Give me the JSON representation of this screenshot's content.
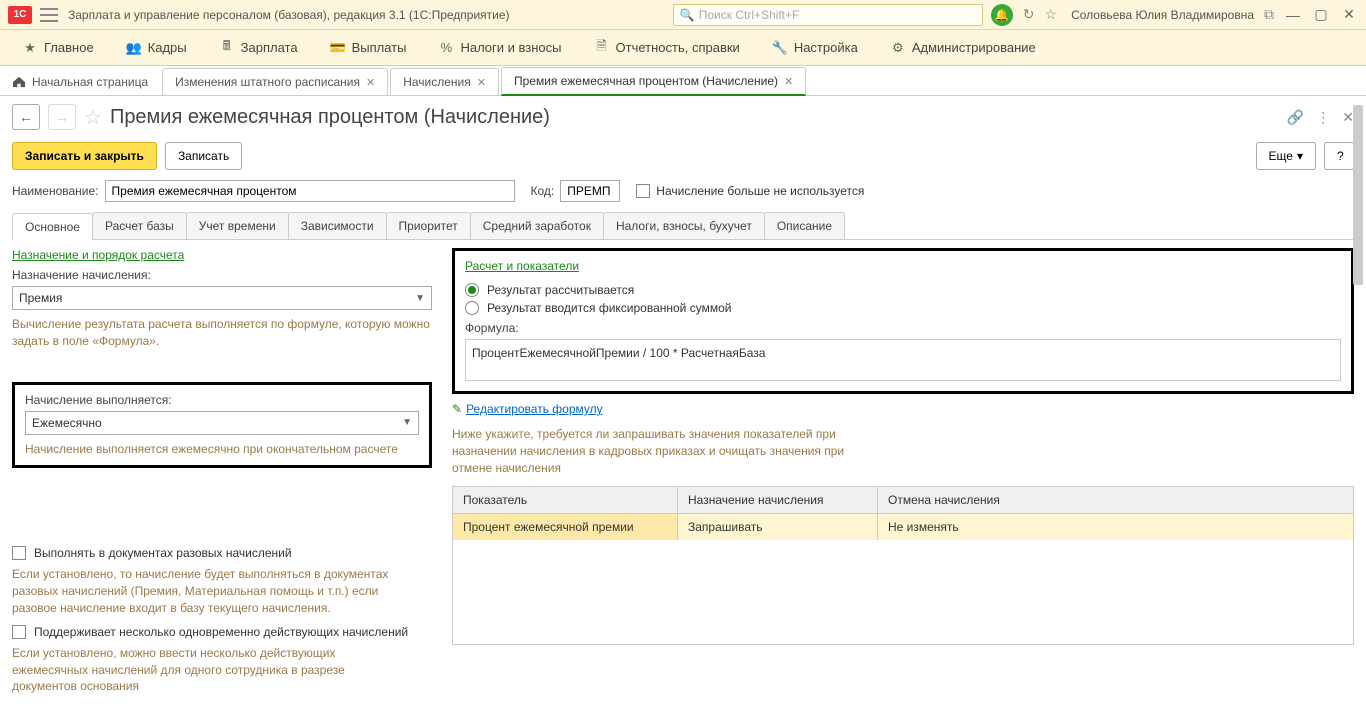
{
  "titlebar": {
    "app_title": "Зарплата и управление персоналом (базовая), редакция 3.1  (1С:Предприятие)",
    "search_placeholder": "Поиск Ctrl+Shift+F",
    "user": "Соловьева Юлия Владимировна"
  },
  "main_menu": [
    "Главное",
    "Кадры",
    "Зарплата",
    "Выплаты",
    "Налоги и взносы",
    "Отчетность, справки",
    "Настройка",
    "Администрирование"
  ],
  "tabs": {
    "home": "Начальная страница",
    "t1": "Изменения штатного расписания",
    "t2": "Начисления",
    "t3": "Премия ежемесячная процентом (Начисление)"
  },
  "page": {
    "title": "Премия ежемесячная процентом (Начисление)",
    "save_close": "Записать и закрыть",
    "save": "Записать",
    "more": "Еще",
    "help": "?"
  },
  "header_fields": {
    "name_label": "Наименование:",
    "name_value": "Премия ежемесячная процентом",
    "code_label": "Код:",
    "code_value": "ПРЕМП",
    "not_used": "Начисление больше не используется"
  },
  "sub_tabs": [
    "Основное",
    "Расчет базы",
    "Учет времени",
    "Зависимости",
    "Приоритет",
    "Средний заработок",
    "Налоги, взносы, бухучет",
    "Описание"
  ],
  "left": {
    "section": "Назначение и порядок расчета",
    "purpose_label": "Назначение начисления:",
    "purpose_value": "Премия",
    "purpose_hint": "Вычисление результата расчета выполняется по формуле, которую можно задать в поле «Формула».",
    "freq_label": "Начисление выполняется:",
    "freq_value": "Ежемесячно",
    "freq_hint": "Начисление выполняется ежемесячно при окончательном расчете",
    "cb1": "Выполнять в документах разовых начислений",
    "cb1_hint": "Если установлено, то начисление будет выполняться в документах разовых начислений (Премия, Материальная помощь и т.п.) если разовое начисление входит в базу текущего начисления.",
    "cb2": "Поддерживает несколько одновременно действующих начислений",
    "cb2_hint": "Если установлено, можно ввести несколько действующих ежемесячных начислений для одного сотрудника в разрезе документов основания"
  },
  "right": {
    "section": "Расчет и показатели",
    "r1": "Результат рассчитывается",
    "r2": "Результат вводится фиксированной суммой",
    "formula_label": "Формула:",
    "formula": "ПроцентЕжемесячнойПремии / 100 * РасчетнаяБаза",
    "edit_link": "Редактировать формулу",
    "info": "Ниже укажите, требуется ли запрашивать значения показателей при назначении начисления в кадровых приказах и очищать значения при отмене начисления",
    "th1": "Показатель",
    "th2": "Назначение начисления",
    "th3": "Отмена начисления",
    "td1": "Процент ежемесячной премии",
    "td2": "Запрашивать",
    "td3": "Не изменять"
  }
}
